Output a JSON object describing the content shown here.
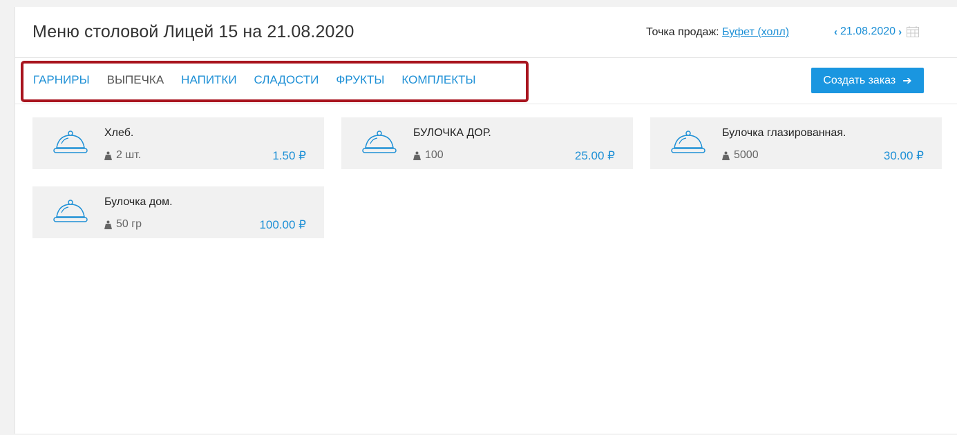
{
  "header": {
    "title": "Меню столовой Лицей 15 на 21.08.2020",
    "point_label": "Точка продаж:",
    "point_value": "Буфет (холл)",
    "prev": "‹",
    "date": "21.08.2020",
    "next": "›"
  },
  "tabs": [
    {
      "label": "ГАРНИРЫ",
      "active": false
    },
    {
      "label": "ВЫПЕЧКА",
      "active": true
    },
    {
      "label": "НАПИТКИ",
      "active": false
    },
    {
      "label": "СЛАДОСТИ",
      "active": false
    },
    {
      "label": "ФРУКТЫ",
      "active": false
    },
    {
      "label": "КОМПЛЕКТЫ",
      "active": false
    }
  ],
  "create_button": {
    "label": "Создать заказ",
    "arrow": "➔"
  },
  "items": [
    {
      "name": "Хлеб.",
      "weight": "2 шт.",
      "price": "1.50 ₽"
    },
    {
      "name": "БУЛОЧКА ДОР.",
      "weight": "100",
      "price": "25.00 ₽"
    },
    {
      "name": "Булочка глазированная.",
      "weight": "5000",
      "price": "30.00 ₽"
    },
    {
      "name": "Булочка дом.",
      "weight": "50 гр",
      "price": "100.00 ₽"
    }
  ],
  "colors": {
    "accent": "#1e90d6",
    "button": "#1a96e0",
    "highlight": "#a8141e"
  }
}
